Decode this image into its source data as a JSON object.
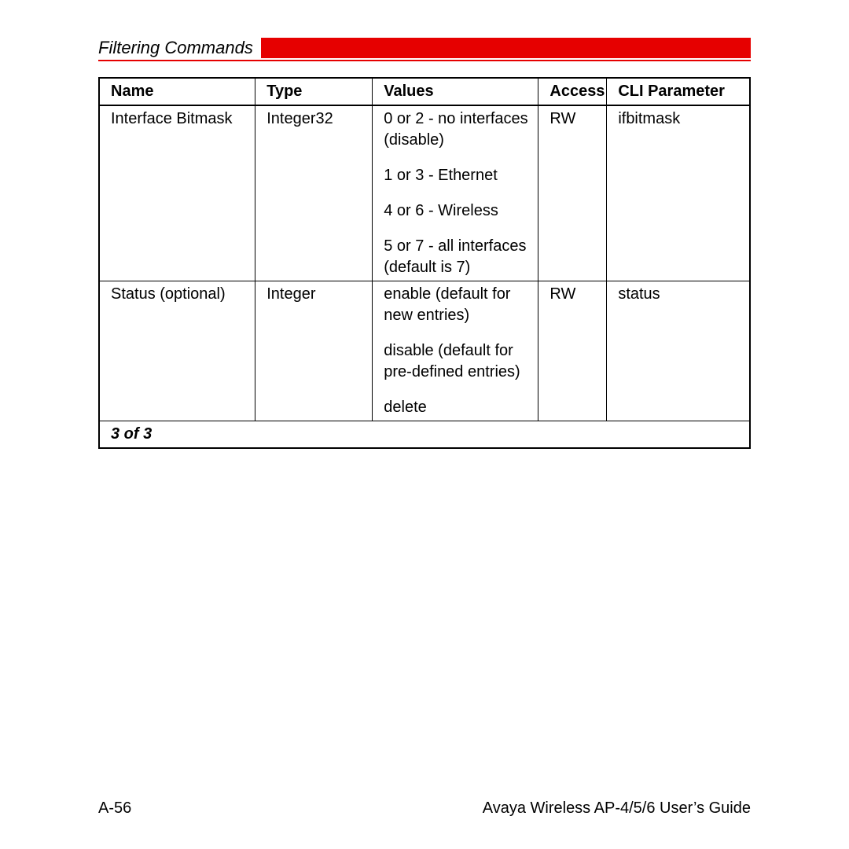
{
  "header": {
    "section_title": "Filtering Commands"
  },
  "table": {
    "headers": {
      "name": "Name",
      "type": "Type",
      "values": "Values",
      "access": "Access",
      "cli": "CLI Parameter"
    },
    "rows": [
      {
        "name": "Interface Bitmask",
        "type": "Integer32",
        "values": [
          "0 or 2 - no interfaces (disable)",
          "1 or 3 - Ethernet",
          "4 or 6 - Wireless",
          "5 or 7 - all interfaces (default is 7)"
        ],
        "access": "RW",
        "cli": "ifbitmask"
      },
      {
        "name": "Status (optional)",
        "type": "Integer",
        "values": [
          "enable (default for new entries)",
          "disable (default for pre-defined entries)",
          "delete"
        ],
        "access": "RW",
        "cli": "status"
      }
    ],
    "caption": "3 of 3"
  },
  "footer": {
    "page": "A-56",
    "doc": "Avaya Wireless AP-4/5/6 User’s Guide"
  }
}
